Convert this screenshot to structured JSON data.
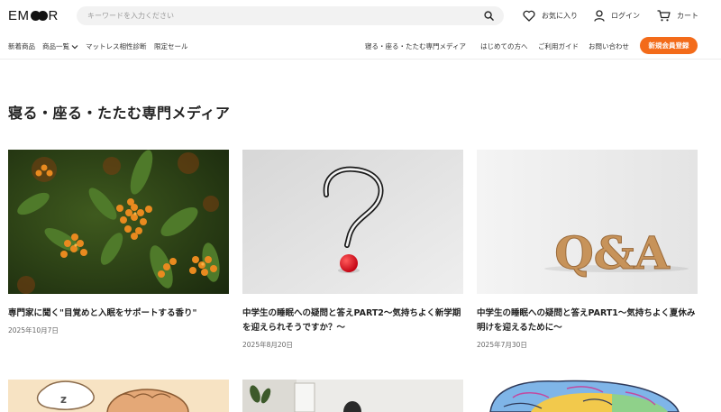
{
  "header": {
    "logo": "EMCOOR",
    "search_placeholder": "キーワードを入力ください",
    "favorites": "お気に入り",
    "login": "ログイン",
    "cart": "カート"
  },
  "nav": {
    "left": [
      "新着商品",
      "商品一覧",
      "マットレス相性診断",
      "限定セール"
    ],
    "right": [
      "寝る・座る・たたむ専門メディア",
      "はじめての方へ",
      "ご利用ガイド",
      "お問い合わせ"
    ],
    "register": "新規会員登録"
  },
  "page": {
    "title": "寝る・座る・たたむ専門メディア"
  },
  "articles": [
    {
      "title": "専門家に聞く\"目覚めと入眠をサポートする香り\"",
      "date": "2025年10月7日"
    },
    {
      "title": "中学生の睡眠への疑問と答えPART2～気持ちよく新学期を迎えられそうですか？～",
      "date": "2025年8月20日"
    },
    {
      "title": "中学生の睡眠への疑問と答えPART1～気持ちよく夏休み明けを迎えるために～",
      "date": "2025年7月30日",
      "image_text": "Q&A"
    }
  ],
  "colors": {
    "accent": "#f36b1a"
  }
}
